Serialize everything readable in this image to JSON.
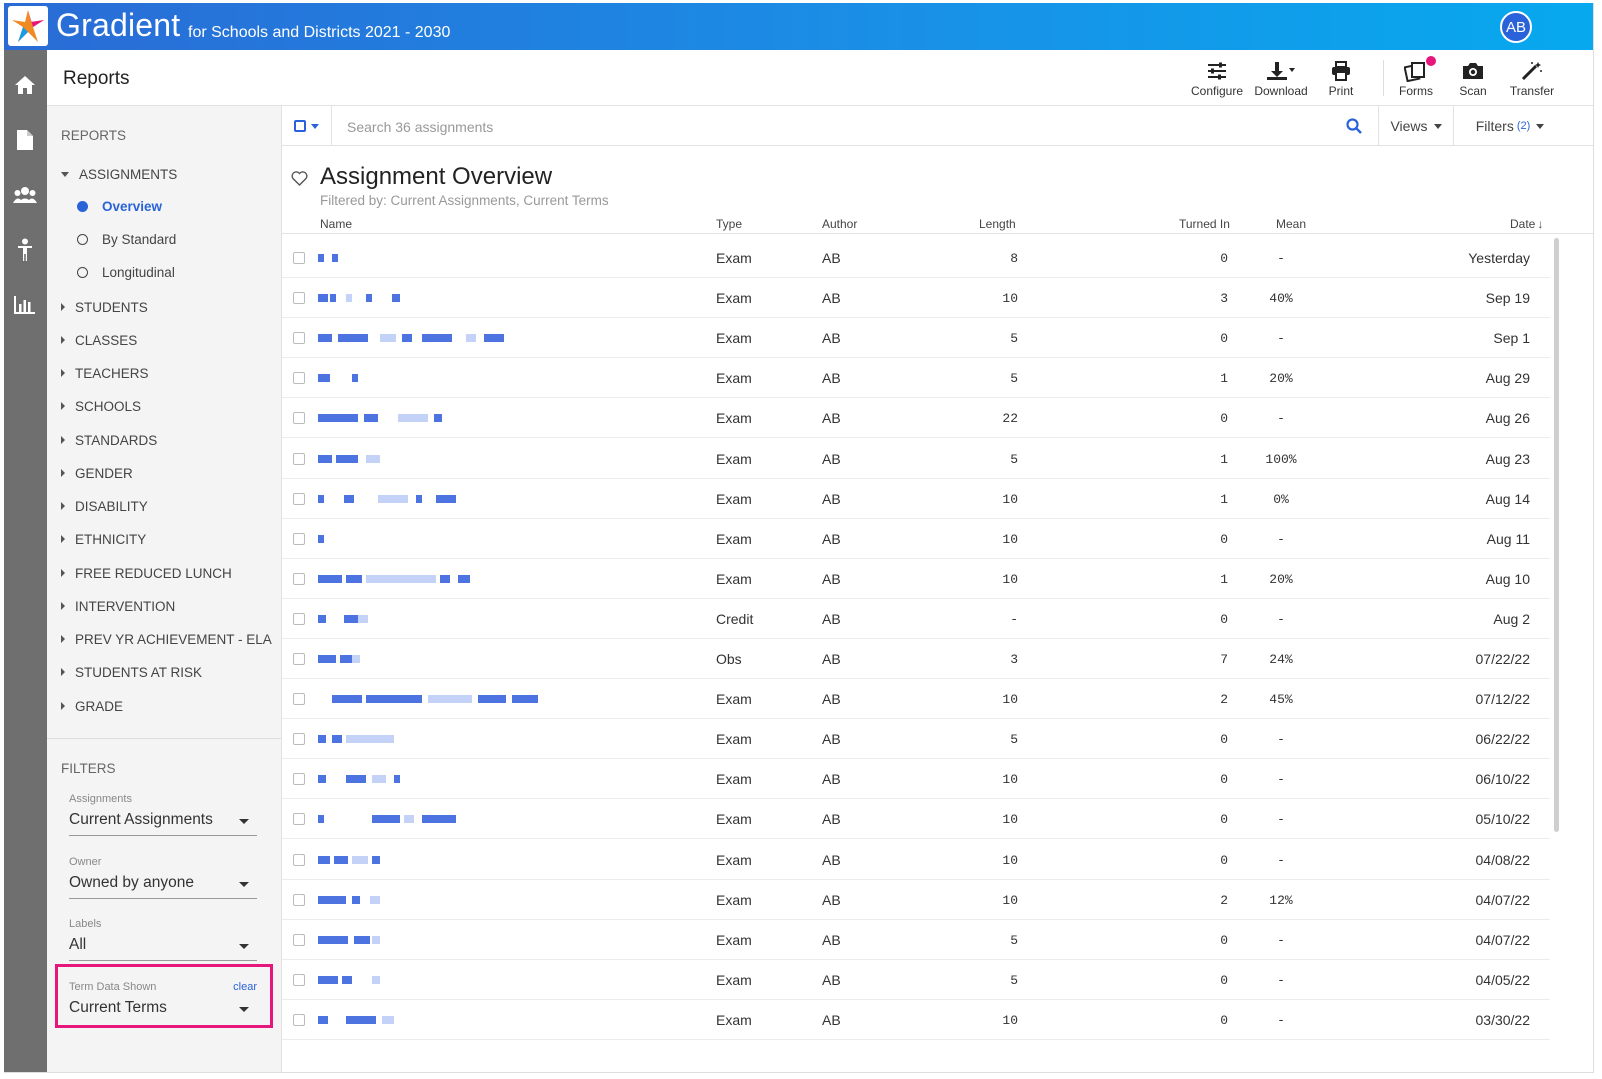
{
  "app": {
    "brand": "Gradient",
    "subtitle": "for Schools and Districts 2021 - 2030",
    "avatar": "AB"
  },
  "header": {
    "title": "Reports",
    "tools": [
      {
        "label": "Configure",
        "icon": "sliders-icon"
      },
      {
        "label": "Download",
        "icon": "download-icon"
      },
      {
        "label": "Print",
        "icon": "printer-icon"
      },
      {
        "label": "Forms",
        "icon": "forms-icon"
      },
      {
        "label": "Scan",
        "icon": "camera-icon"
      },
      {
        "label": "Transfer",
        "icon": "magic-wand-icon"
      }
    ]
  },
  "rail": [
    "home-icon",
    "document-icon",
    "users-icon",
    "student-icon",
    "bar-chart-icon"
  ],
  "sidebar": {
    "reports_heading": "REPORTS",
    "assignments": "ASSIGNMENTS",
    "sub_items": [
      "Overview",
      "By Standard",
      "Longitudinal"
    ],
    "sections": [
      "STUDENTS",
      "CLASSES",
      "TEACHERS",
      "SCHOOLS",
      "STANDARDS",
      "GENDER",
      "DISABILITY",
      "ETHNICITY",
      "FREE REDUCED LUNCH",
      "INTERVENTION",
      "PREV YR ACHIEVEMENT - ELA",
      "STUDENTS AT RISK",
      "GRADE"
    ],
    "filters_heading": "FILTERS",
    "filters": [
      {
        "label": "Assignments",
        "value": "Current Assignments"
      },
      {
        "label": "Owner",
        "value": "Owned by anyone"
      },
      {
        "label": "Labels",
        "value": "All"
      },
      {
        "label": "Term Data Shown",
        "value": "Current Terms",
        "clear": "clear"
      }
    ]
  },
  "search": {
    "placeholder": "Search 36 assignments",
    "views": "Views",
    "filters": "Filters",
    "filters_count": "(2)"
  },
  "main": {
    "title": "Assignment Overview",
    "subtitle": "Filtered by: Current Assignments, Current Terms",
    "columns": [
      "Name",
      "Type",
      "Author",
      "Length",
      "Turned In",
      "Mean",
      "Date"
    ],
    "rows": [
      {
        "type": "Exam",
        "author": "AB",
        "length": "8",
        "turned_in": "0",
        "mean": "-",
        "date": "Yesterday"
      },
      {
        "type": "Exam",
        "author": "AB",
        "length": "10",
        "turned_in": "3",
        "mean": "40%",
        "date": "Sep 19"
      },
      {
        "type": "Exam",
        "author": "AB",
        "length": "5",
        "turned_in": "0",
        "mean": "-",
        "date": "Sep 1"
      },
      {
        "type": "Exam",
        "author": "AB",
        "length": "5",
        "turned_in": "1",
        "mean": "20%",
        "date": "Aug 29"
      },
      {
        "type": "Exam",
        "author": "AB",
        "length": "22",
        "turned_in": "0",
        "mean": "-",
        "date": "Aug 26"
      },
      {
        "type": "Exam",
        "author": "AB",
        "length": "5",
        "turned_in": "1",
        "mean": "100%",
        "date": "Aug 23"
      },
      {
        "type": "Exam",
        "author": "AB",
        "length": "10",
        "turned_in": "1",
        "mean": "0%",
        "date": "Aug 14"
      },
      {
        "type": "Exam",
        "author": "AB",
        "length": "10",
        "turned_in": "0",
        "mean": "-",
        "date": "Aug 11"
      },
      {
        "type": "Exam",
        "author": "AB",
        "length": "10",
        "turned_in": "1",
        "mean": "20%",
        "date": "Aug 10"
      },
      {
        "type": "Credit",
        "author": "AB",
        "length": "-",
        "turned_in": "0",
        "mean": "-",
        "date": "Aug 2"
      },
      {
        "type": "Obs",
        "author": "AB",
        "length": "3",
        "turned_in": "7",
        "mean": "24%",
        "date": "07/22/22"
      },
      {
        "type": "Exam",
        "author": "AB",
        "length": "10",
        "turned_in": "2",
        "mean": "45%",
        "date": "07/12/22"
      },
      {
        "type": "Exam",
        "author": "AB",
        "length": "5",
        "turned_in": "0",
        "mean": "-",
        "date": "06/22/22"
      },
      {
        "type": "Exam",
        "author": "AB",
        "length": "10",
        "turned_in": "0",
        "mean": "-",
        "date": "06/10/22"
      },
      {
        "type": "Exam",
        "author": "AB",
        "length": "10",
        "turned_in": "0",
        "mean": "-",
        "date": "05/10/22"
      },
      {
        "type": "Exam",
        "author": "AB",
        "length": "10",
        "turned_in": "0",
        "mean": "-",
        "date": "04/08/22"
      },
      {
        "type": "Exam",
        "author": "AB",
        "length": "10",
        "turned_in": "2",
        "mean": "12%",
        "date": "04/07/22"
      },
      {
        "type": "Exam",
        "author": "AB",
        "length": "5",
        "turned_in": "0",
        "mean": "-",
        "date": "04/07/22"
      },
      {
        "type": "Exam",
        "author": "AB",
        "length": "5",
        "turned_in": "0",
        "mean": "-",
        "date": "04/05/22"
      },
      {
        "type": "Exam",
        "author": "AB",
        "length": "10",
        "turned_in": "0",
        "mean": "-",
        "date": "03/30/22"
      }
    ]
  },
  "colors": {
    "accent": "#2a63d9",
    "highlight": "#e6167c",
    "rail": "#6f6f6f"
  }
}
